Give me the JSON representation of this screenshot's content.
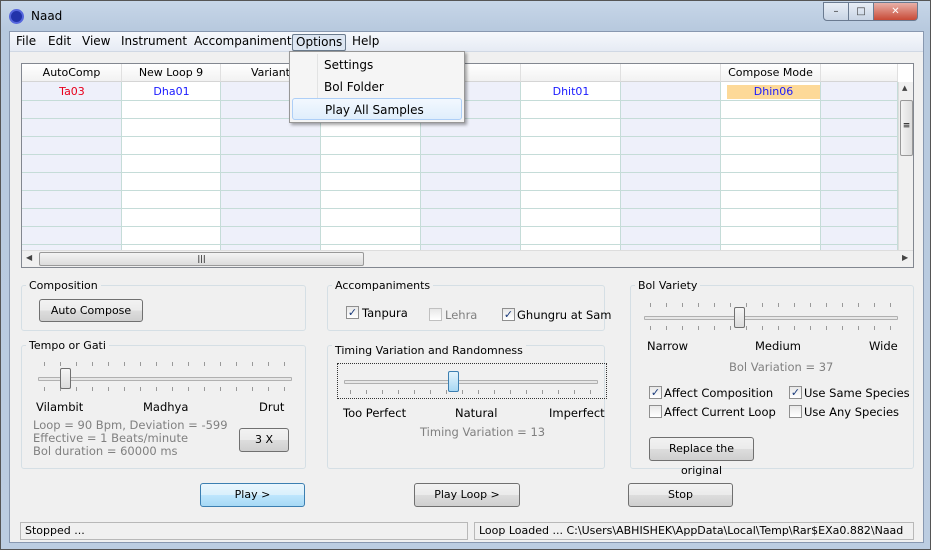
{
  "window": {
    "title": "Naad",
    "minimize": "–",
    "maximize": "□",
    "close": "✕"
  },
  "menubar": [
    "File",
    "Edit",
    "View",
    "Instrument",
    "Accompaniment",
    "Options",
    "Help"
  ],
  "options_menu": [
    "Settings",
    "Bol Folder",
    "Play All Samples"
  ],
  "grid": {
    "headers": [
      "AutoComp",
      "New Loop 9",
      "Variant",
      "",
      "",
      "",
      "",
      "Compose Mode",
      ""
    ],
    "row1": [
      "Ta03",
      "Dha01",
      "",
      "",
      "",
      "Dhit01",
      "",
      "Dhin06",
      ""
    ],
    "colors": {
      "autocomp": "#e8001c",
      "bol": "#1a1aff",
      "selected_bg": "#fdd998"
    }
  },
  "composition": {
    "label": "Composition",
    "auto_compose": "Auto Compose"
  },
  "tempo": {
    "label": "Tempo or Gati",
    "slider_value": 0.09,
    "left": "Vilambit",
    "mid": "Madhya",
    "right": "Drut",
    "line1": "Loop = 90 Bpm, Deviation = -599",
    "line2": "Effective = 1 Beats/minute",
    "line3": "Bol duration = 60000 ms",
    "mult_button": "3 X"
  },
  "accompaniments": {
    "label": "Accompaniments",
    "tanpura": "Tanpura",
    "tanpura_checked": true,
    "lehra": "Lehra",
    "lehra_checked": false,
    "ghungru": "Ghungru at Sam",
    "ghungru_checked": true
  },
  "timing": {
    "label": "Timing Variation and Randomness",
    "slider_value": 0.43,
    "left": "Too Perfect",
    "mid": "Natural",
    "right": "Imperfect",
    "readout": "Timing Variation = 13"
  },
  "bol_variety": {
    "label": "Bol Variety",
    "slider_value": 0.37,
    "left": "Narrow",
    "mid": "Medium",
    "right": "Wide",
    "readout": "Bol Variation = 37",
    "affect_comp": "Affect Composition",
    "affect_comp_checked": true,
    "affect_loop": "Affect Current Loop",
    "affect_loop_checked": false,
    "same_species": "Use Same Species",
    "same_species_checked": true,
    "any_species": "Use Any Species",
    "any_species_checked": false,
    "replace": "Replace the original"
  },
  "buttons": {
    "play": "Play >",
    "play_loop": "Play Loop >",
    "stop": "Stop"
  },
  "status": {
    "left": "Stopped ...",
    "right": "Loop Loaded ...  C:\\Users\\ABHISHEK\\AppData\\Local\\Temp\\Rar$EXa0.882\\Naad"
  }
}
